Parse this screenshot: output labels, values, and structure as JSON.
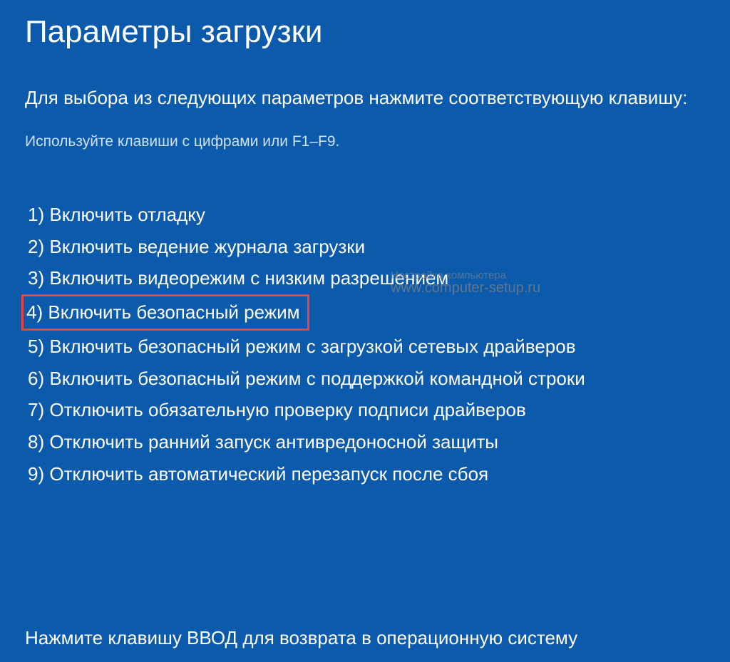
{
  "title": "Параметры загрузки",
  "instruction": "Для выбора из следующих параметров нажмите соответствующую клавишу:",
  "hint": "Используйте клавиши с цифрами или F1–F9.",
  "options": [
    {
      "num": "1)",
      "label": "Включить отладку"
    },
    {
      "num": "2)",
      "label": "Включить ведение журнала загрузки"
    },
    {
      "num": "3)",
      "label": "Включить видеорежим с низким разрешением"
    },
    {
      "num": "4)",
      "label": "Включить безопасный режим",
      "highlighted": true
    },
    {
      "num": "5)",
      "label": "Включить безопасный режим с загрузкой сетевых драйверов"
    },
    {
      "num": "6)",
      "label": "Включить безопасный режим с поддержкой командной строки"
    },
    {
      "num": "7)",
      "label": "Отключить обязательную проверку подписи драйверов"
    },
    {
      "num": "8)",
      "label": "Отключить ранний запуск антивредоносной защиты"
    },
    {
      "num": "9)",
      "label": "Отключить автоматический перезапуск после сбоя"
    }
  ],
  "footer": "Нажмите клавишу ВВОД для возврата в операционную систему",
  "watermark": {
    "line1": "Настройка компьютера",
    "line2": "www.computer-setup.ru"
  }
}
